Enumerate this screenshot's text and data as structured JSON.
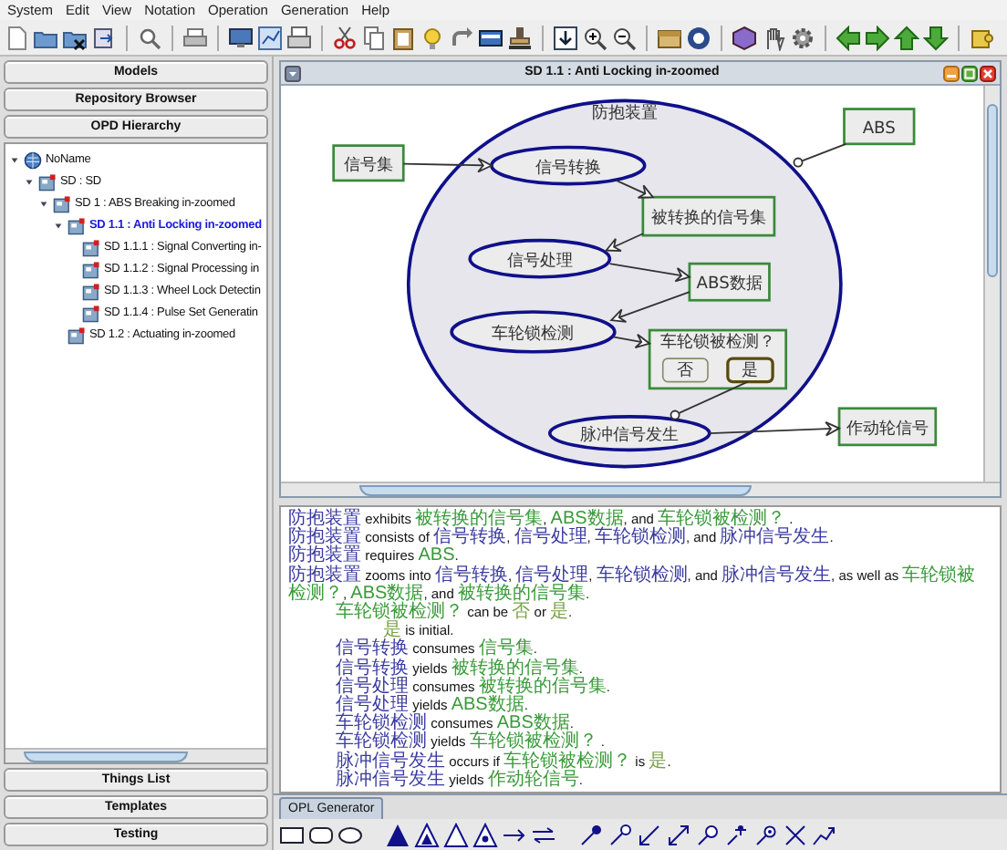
{
  "menu_bar": [
    "System",
    "Edit",
    "View",
    "Notation",
    "Operation",
    "Generation",
    "Help"
  ],
  "left_panel": {
    "top_buttons": [
      "Models",
      "Repository Browser",
      "OPD Hierarchy"
    ],
    "tree": [
      {
        "label": "NoName",
        "kind": "root",
        "expanded": true,
        "selected": false,
        "children": [
          {
            "label": "SD : SD",
            "kind": "diagram",
            "expanded": true,
            "selected": false,
            "children": [
              {
                "label": "SD 1 : ABS Breaking in-zoomed",
                "kind": "diagram",
                "expanded": true,
                "selected": false,
                "children": [
                  {
                    "label": "SD 1.1 : Anti Locking in-zoomed",
                    "kind": "diagram",
                    "expanded": true,
                    "selected": true,
                    "children": [
                      {
                        "label": "SD 1.1.1 : Signal Converting in-",
                        "kind": "diagram",
                        "selected": false
                      },
                      {
                        "label": "SD 1.1.2 : Signal Processing in",
                        "kind": "diagram",
                        "selected": false
                      },
                      {
                        "label": "SD 1.1.3 : Wheel Lock Detectin",
                        "kind": "diagram",
                        "selected": false
                      },
                      {
                        "label": "SD 1.1.4 : Pulse Set Generatin",
                        "kind": "diagram",
                        "selected": false
                      }
                    ]
                  },
                  {
                    "label": "SD 1.2 : Actuating in-zoomed",
                    "kind": "diagram",
                    "selected": false
                  }
                ]
              }
            ]
          }
        ]
      }
    ],
    "bottom_buttons": [
      "Things List",
      "Templates",
      "Testing"
    ]
  },
  "diagram_window": {
    "title": "SD 1.1 : Anti Locking in-zoomed",
    "things": [
      {
        "kind": "process",
        "label": "防抱装置"
      },
      {
        "kind": "object",
        "label": "ABS"
      },
      {
        "kind": "object",
        "label": "信号集"
      },
      {
        "kind": "process",
        "label": "信号转换"
      },
      {
        "kind": "object",
        "label": "被转换的信号集"
      },
      {
        "kind": "process",
        "label": "信号处理"
      },
      {
        "kind": "object",
        "label": "ABS数据"
      },
      {
        "kind": "process",
        "label": "车轮锁检测"
      },
      {
        "kind": "object",
        "label": "车轮锁被检测？",
        "states": [
          {
            "label": "否",
            "initial": false
          },
          {
            "label": "是",
            "initial": true
          }
        ]
      },
      {
        "kind": "process",
        "label": "脉冲信号发生"
      },
      {
        "kind": "object",
        "label": "作动轮信号"
      }
    ]
  },
  "opl": {
    "lines": [
      {
        "segments": [
          {
            "kind": "process",
            "text": "防抱装置"
          },
          {
            "kind": "plain",
            "text": " exhibits "
          },
          {
            "kind": "object",
            "text": "被转换的信号集"
          },
          {
            "kind": "plain",
            "text": ", "
          },
          {
            "kind": "object",
            "text": "ABS数据"
          },
          {
            "kind": "plain",
            "text": ", and "
          },
          {
            "kind": "object",
            "text": "车轮锁被检测？"
          },
          {
            "kind": "plain",
            "text": " ."
          }
        ]
      },
      {
        "segments": [
          {
            "kind": "process",
            "text": "防抱装置"
          },
          {
            "kind": "plain",
            "text": " consists of "
          },
          {
            "kind": "process",
            "text": "信号转换"
          },
          {
            "kind": "plain",
            "text": ", "
          },
          {
            "kind": "process",
            "text": "信号处理"
          },
          {
            "kind": "plain",
            "text": ", "
          },
          {
            "kind": "process",
            "text": "车轮锁检测"
          },
          {
            "kind": "plain",
            "text": ", and "
          },
          {
            "kind": "process",
            "text": "脉冲信号发生"
          },
          {
            "kind": "plain",
            "text": "."
          }
        ]
      },
      {
        "segments": [
          {
            "kind": "process",
            "text": "防抱装置"
          },
          {
            "kind": "plain",
            "text": " requires "
          },
          {
            "kind": "object",
            "text": "ABS"
          },
          {
            "kind": "plain",
            "text": "."
          }
        ]
      },
      {
        "segments": [
          {
            "kind": "process",
            "text": "防抱装置"
          },
          {
            "kind": "plain",
            "text": " zooms into "
          },
          {
            "kind": "process",
            "text": "信号转换"
          },
          {
            "kind": "plain",
            "text": ", "
          },
          {
            "kind": "process",
            "text": "信号处理"
          },
          {
            "kind": "plain",
            "text": ", "
          },
          {
            "kind": "process",
            "text": "车轮锁检测"
          },
          {
            "kind": "plain",
            "text": ", and "
          },
          {
            "kind": "process",
            "text": "脉冲信号发生"
          },
          {
            "kind": "plain",
            "text": ", as well as "
          },
          {
            "kind": "object",
            "text": "车轮锁被检测？"
          },
          {
            "kind": "plain",
            "text": ", "
          },
          {
            "kind": "object",
            "text": "ABS数据"
          },
          {
            "kind": "plain",
            "text": ", and "
          },
          {
            "kind": "object",
            "text": "被转换的信号集"
          },
          {
            "kind": "plain",
            "text": "."
          }
        ],
        "children": [
          {
            "segments": [
              {
                "kind": "object",
                "text": "车轮锁被检测？"
              },
              {
                "kind": "plain",
                "text": " can be "
              },
              {
                "kind": "state",
                "text": "否"
              },
              {
                "kind": "plain",
                "text": " or "
              },
              {
                "kind": "state",
                "text": "是"
              },
              {
                "kind": "plain",
                "text": "."
              }
            ],
            "children": [
              {
                "segments": [
                  {
                    "kind": "state",
                    "text": "是"
                  },
                  {
                    "kind": "plain",
                    "text": " is initial."
                  }
                ]
              }
            ]
          },
          {
            "segments": [
              {
                "kind": "process",
                "text": "信号转换"
              },
              {
                "kind": "plain",
                "text": " consumes "
              },
              {
                "kind": "object",
                "text": "信号集"
              },
              {
                "kind": "plain",
                "text": "."
              }
            ]
          },
          {
            "segments": [
              {
                "kind": "process",
                "text": "信号转换"
              },
              {
                "kind": "plain",
                "text": " yields "
              },
              {
                "kind": "object",
                "text": "被转换的信号集"
              },
              {
                "kind": "plain",
                "text": "."
              }
            ]
          },
          {
            "segments": [
              {
                "kind": "process",
                "text": "信号处理"
              },
              {
                "kind": "plain",
                "text": " consumes "
              },
              {
                "kind": "object",
                "text": "被转换的信号集"
              },
              {
                "kind": "plain",
                "text": "."
              }
            ]
          },
          {
            "segments": [
              {
                "kind": "process",
                "text": "信号处理"
              },
              {
                "kind": "plain",
                "text": " yields "
              },
              {
                "kind": "object",
                "text": "ABS数据"
              },
              {
                "kind": "plain",
                "text": "."
              }
            ]
          },
          {
            "segments": [
              {
                "kind": "process",
                "text": "车轮锁检测"
              },
              {
                "kind": "plain",
                "text": " consumes "
              },
              {
                "kind": "object",
                "text": "ABS数据"
              },
              {
                "kind": "plain",
                "text": "."
              }
            ]
          },
          {
            "segments": [
              {
                "kind": "process",
                "text": "车轮锁检测"
              },
              {
                "kind": "plain",
                "text": " yields "
              },
              {
                "kind": "object",
                "text": "车轮锁被检测？"
              },
              {
                "kind": "plain",
                "text": " ."
              }
            ]
          },
          {
            "segments": [
              {
                "kind": "process",
                "text": "脉冲信号发生"
              },
              {
                "kind": "plain",
                "text": " occurs if "
              },
              {
                "kind": "object",
                "text": "车轮锁被检测？"
              },
              {
                "kind": "plain",
                "text": " is "
              },
              {
                "kind": "state",
                "text": "是"
              },
              {
                "kind": "plain",
                "text": "."
              }
            ]
          },
          {
            "segments": [
              {
                "kind": "process",
                "text": "脉冲信号发生"
              },
              {
                "kind": "plain",
                "text": " yields "
              },
              {
                "kind": "object",
                "text": "作动轮信号"
              },
              {
                "kind": "plain",
                "text": "."
              }
            ]
          }
        ]
      }
    ]
  },
  "tabs": [
    {
      "label": "OPL Generator",
      "selected": true
    }
  ]
}
